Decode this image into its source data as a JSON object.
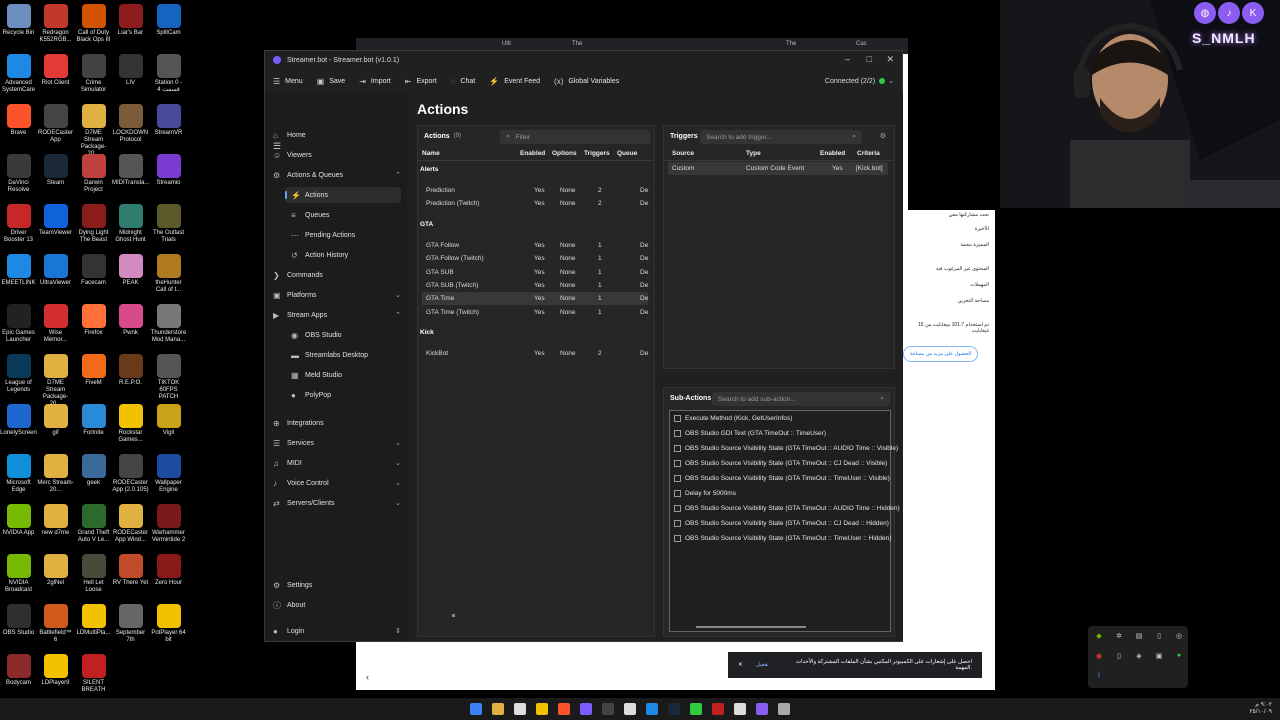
{
  "desktop_icons": [
    {
      "label": "Recycle Bin",
      "color": "#6c8ebf"
    },
    {
      "label": "Redragon K552RGB...",
      "color": "#c0392b"
    },
    {
      "label": "Call of Duty Black Ops III",
      "color": "#d35400"
    },
    {
      "label": "Liar's Bar",
      "color": "#8e1b1b"
    },
    {
      "label": "SplitCam",
      "color": "#1565c0"
    },
    {
      "label": "Advanced SystemCare",
      "color": "#1e88e5"
    },
    {
      "label": "Riot Client",
      "color": "#e53935"
    },
    {
      "label": "Crime Simulator",
      "color": "#424242"
    },
    {
      "label": "LIV",
      "color": "#333333"
    },
    {
      "label": "Station 0 - قسمت 4",
      "color": "#555555"
    },
    {
      "label": "Brave",
      "color": "#fb542b"
    },
    {
      "label": "RODECaster App",
      "color": "#444444"
    },
    {
      "label": "D7ME Stream Package-20...",
      "color": "#e0b040"
    },
    {
      "label": "LOCKDOWN Protocol",
      "color": "#7a5c3a"
    },
    {
      "label": "StreamVR",
      "color": "#4a4a9a"
    },
    {
      "label": "DaVinci Resolve",
      "color": "#3a3a3a"
    },
    {
      "label": "Steam",
      "color": "#1b2838"
    },
    {
      "label": "Darwin Project",
      "color": "#c04040"
    },
    {
      "label": "MIDITransla...",
      "color": "#555555"
    },
    {
      "label": "Streamio",
      "color": "#7a3bd1"
    },
    {
      "label": "Driver Booster 13",
      "color": "#c62828"
    },
    {
      "label": "TeamViewer",
      "color": "#0e63d8"
    },
    {
      "label": "Dying Light The Beast",
      "color": "#8b1c1c"
    },
    {
      "label": "Midnight Ghost Hunt",
      "color": "#2e7d6e"
    },
    {
      "label": "The Outlast Trials",
      "color": "#5a5a2a"
    },
    {
      "label": "EMEETLINK",
      "color": "#1e88e5"
    },
    {
      "label": "UltraViewer",
      "color": "#1976d2"
    },
    {
      "label": "Facecam",
      "color": "#333333"
    },
    {
      "label": "PEAK",
      "color": "#d48ac0"
    },
    {
      "label": "theHunter Call of t...",
      "color": "#b07a20"
    },
    {
      "label": "Epic Games Launcher",
      "color": "#222222"
    },
    {
      "label": "Wise Memor...",
      "color": "#d32f2f"
    },
    {
      "label": "Firefox",
      "color": "#ff7139"
    },
    {
      "label": "Pwnk",
      "color": "#d84b8a"
    },
    {
      "label": "Thunderstore Mod Mana...",
      "color": "#777777"
    },
    {
      "label": "League of Legends",
      "color": "#0a3a5a"
    },
    {
      "label": "D7ME Stream Package-20...",
      "color": "#e0b040"
    },
    {
      "label": "FiveM",
      "color": "#f06a1a"
    },
    {
      "label": "R.E.P.O.",
      "color": "#6a3a1a"
    },
    {
      "label": "TIKTOK 60FPS PATCH",
      "color": "#555555"
    },
    {
      "label": "LonelyScreen",
      "color": "#1e66d0"
    },
    {
      "label": "gif",
      "color": "#e0b040"
    },
    {
      "label": "Fortnite",
      "color": "#2a8ad6"
    },
    {
      "label": "Rockstar Games...",
      "color": "#f2c200"
    },
    {
      "label": "Vigil",
      "color": "#c9a21a"
    },
    {
      "label": "Microsoft Edge",
      "color": "#0f8fd8"
    },
    {
      "label": "Merc Stream-20...",
      "color": "#e0b040"
    },
    {
      "label": "geek",
      "color": "#3a6a9a"
    },
    {
      "label": "RODECaster App (2.0.105)",
      "color": "#444444"
    },
    {
      "label": "Wallpaper Engine",
      "color": "#1e4aa0"
    },
    {
      "label": "NVIDIA App",
      "color": "#76b900"
    },
    {
      "label": "new d7me",
      "color": "#e0b040"
    },
    {
      "label": "Grand Theft Auto V Le...",
      "color": "#2a6a2a"
    },
    {
      "label": "RODECaster App Wind...",
      "color": "#e0b040"
    },
    {
      "label": "Warhammer Vermintide 2",
      "color": "#7a1a1a"
    },
    {
      "label": "NVIDIA Broadcast",
      "color": "#76b900"
    },
    {
      "label": "2glNel",
      "color": "#e0b040"
    },
    {
      "label": "Hell Let Loose",
      "color": "#4a4a3a"
    },
    {
      "label": "RV There Yet",
      "color": "#c04a2a"
    },
    {
      "label": "Zero Hour",
      "color": "#8a1a1a"
    },
    {
      "label": "OBS Studio",
      "color": "#302e31"
    },
    {
      "label": "Battlefield™ 6",
      "color": "#d05a1a"
    },
    {
      "label": "LDMultiPla...",
      "color": "#f2c200"
    },
    {
      "label": "September 7th",
      "color": "#666666"
    },
    {
      "label": "PotPlayer 64 bit",
      "color": "#f2c200"
    },
    {
      "label": "Bodycam",
      "color": "#8a2a2a"
    },
    {
      "label": "LDPlayer9",
      "color": "#f2c200"
    },
    {
      "label": "SILENT BREATH",
      "color": "#c02020"
    }
  ],
  "browser": {
    "tabs": [
      "Ulti",
      "The",
      "The",
      "Cas"
    ],
    "side_items": [
      "تحت مشاركتها معي",
      "الأخيرة",
      "المميزة بنجمة",
      "المحتوى غير المرغوب فيه",
      "المهملات",
      "مساحة التخزين"
    ],
    "storage_text": "تم استخدام 101.7 ميغابايت من 15 غيغابايت",
    "storage_button": "الحصول على مزيد من مساحة",
    "toast_text": "احصل على إشعارات على الكمبيوتر المكتبي بشأن الملفات المشتركة والأحداث المهمة.",
    "toast_action": "تفعيل"
  },
  "window": {
    "title": "Streamer.bot - Streamer.bot (v1.0.1)",
    "toolbar": [
      {
        "label": "Menu",
        "icon": "hamburger-icon"
      },
      {
        "label": "Save",
        "icon": "save-icon"
      },
      {
        "label": "Import",
        "icon": "import-icon"
      },
      {
        "label": "Export",
        "icon": "export-icon"
      },
      {
        "label": "Chat",
        "icon": "chat-icon"
      },
      {
        "label": "Event Feed",
        "icon": "event-feed-icon"
      },
      {
        "label": "Global Variables",
        "icon": "variables-icon"
      }
    ],
    "connected": "Connected (2/2)"
  },
  "sidebar": {
    "items": [
      {
        "label": "Home",
        "icon": "⌂"
      },
      {
        "label": "Viewers",
        "icon": "☺"
      },
      {
        "label": "Actions & Queues",
        "icon": "⚙",
        "chevron": "^"
      },
      {
        "label": "Actions",
        "icon": "⚡",
        "sub": true,
        "active": true
      },
      {
        "label": "Queues",
        "icon": "≡",
        "sub": true
      },
      {
        "label": "Pending Actions",
        "icon": "⋯",
        "sub": true
      },
      {
        "label": "Action History",
        "icon": "↺",
        "sub": true
      },
      {
        "label": "Commands",
        "icon": "❯"
      },
      {
        "label": "Platforms",
        "icon": "▣",
        "chevron": "v"
      },
      {
        "label": "Stream Apps",
        "icon": "▶",
        "chevron": "^"
      },
      {
        "label": "OBS Studio",
        "icon": "◉",
        "sub": true
      },
      {
        "label": "Streamlabs Desktop",
        "icon": "▬",
        "sub": true
      },
      {
        "label": "Meld Studio",
        "icon": "▦",
        "sub": true
      },
      {
        "label": "PolyPop",
        "icon": "●",
        "sub": true
      },
      {
        "label": "Integrations",
        "icon": "⊕"
      },
      {
        "label": "Services",
        "icon": "☰",
        "chevron": "v"
      },
      {
        "label": "MIDI",
        "icon": "♫",
        "chevron": "v"
      },
      {
        "label": "Voice Control",
        "icon": "♪",
        "chevron": "v"
      },
      {
        "label": "Servers/Clients",
        "icon": "⇄",
        "chevron": "v"
      }
    ],
    "settings": "Settings",
    "about": "About",
    "login": "Login"
  },
  "actions_panel": {
    "title": "Actions",
    "page_title": "Actions",
    "count": "(9)",
    "filter_placeholder": "Filter",
    "columns": [
      "Name",
      "Enabled",
      "Options",
      "Triggers",
      "Queue"
    ],
    "groups": [
      {
        "name": "Alerts",
        "rows": [
          {
            "name": "Prediction",
            "enabled": "Yes",
            "options": "None",
            "triggers": "2",
            "queue": "De"
          },
          {
            "name": "Prediction (Twitch)",
            "enabled": "Yes",
            "options": "None",
            "triggers": "2",
            "queue": "De"
          }
        ]
      },
      {
        "name": "GTA",
        "rows": [
          {
            "name": "GTA Follow",
            "enabled": "Yes",
            "options": "None",
            "triggers": "1",
            "queue": "De"
          },
          {
            "name": "GTA Follow (Twitch)",
            "enabled": "Yes",
            "options": "None",
            "triggers": "1",
            "queue": "De"
          },
          {
            "name": "GTA SUB",
            "enabled": "Yes",
            "options": "None",
            "triggers": "1",
            "queue": "De"
          },
          {
            "name": "GTA SUB (Twitch)",
            "enabled": "Yes",
            "options": "None",
            "triggers": "1",
            "queue": "De"
          },
          {
            "name": "GTA Time",
            "enabled": "Yes",
            "options": "None",
            "triggers": "1",
            "queue": "De",
            "selected": true
          },
          {
            "name": "GTA Time (Twitch)",
            "enabled": "Yes",
            "options": "None",
            "triggers": "1",
            "queue": "De"
          }
        ]
      },
      {
        "name": "Kick",
        "rows": [
          {
            "name": "KickBot",
            "enabled": "Yes",
            "options": "None",
            "triggers": "2",
            "queue": "De"
          }
        ]
      }
    ]
  },
  "triggers_panel": {
    "title": "Triggers",
    "search_placeholder": "Search to add trigger...",
    "columns": [
      "Source",
      "Type",
      "Enabled",
      "Criteria"
    ],
    "rows": [
      {
        "source": "Custom",
        "type": "Custom Code Event",
        "enabled": "Yes",
        "criteria": "[Kick.bot]"
      }
    ]
  },
  "subactions_panel": {
    "title": "Sub-Actions",
    "search_placeholder": "Search to add sub-action...",
    "rows": [
      "Execute Method (Kick, GetUserInfos)",
      "OBS Studio GDI Text (GTA TimeOut :: TimeUser)",
      "OBS Studio Source Visibility State (GTA TimeOut :: AUDIO Time :: Visible)",
      "OBS Studio Source Visibility State (GTA TimeOut :: CJ Dead :: Visible)",
      "OBS Studio Source Visibility State (GTA TimeOut :: TimeUser :: Visible)",
      "Delay for 5000ms",
      "OBS Studio Source Visibility State (GTA TimeOut :: AUDIO Time :: Hidden)",
      "OBS Studio Source Visibility State (GTA TimeOut :: CJ Dead :: Hidden)",
      "OBS Studio Source Visibility State (GTA TimeOut :: TimeUser :: Hidden)"
    ]
  },
  "webcam": {
    "overlay_text": "S_NMLH"
  },
  "taskbar": {
    "time": "٩:٠٢ م",
    "date": "٢٥/١٠/٠٩"
  }
}
